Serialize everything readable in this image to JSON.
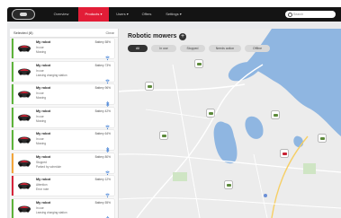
{
  "nav": {
    "items": [
      {
        "label": "Overview",
        "active": false
      },
      {
        "label": "Products ▾",
        "active": true
      },
      {
        "label": "Users ▾",
        "active": false
      },
      {
        "label": "Offers",
        "active": false
      },
      {
        "label": "Settings ▾",
        "active": false
      }
    ],
    "search_placeholder": "Search"
  },
  "sidebar": {
    "header": "Selected (8)",
    "clear": "Clear",
    "cards": [
      {
        "name": "My robot",
        "line1": "In use",
        "line2": "Mowing",
        "battery": "Battery 58%",
        "stripe": "#5db33a",
        "icon": "wifi"
      },
      {
        "name": "My robot",
        "line1": "In use",
        "line2": "Leaving charging station",
        "battery": "Battery 73%",
        "stripe": "#5db33a",
        "icon": "wifi"
      },
      {
        "name": "My robot",
        "line1": "In use",
        "line2": "Mowing",
        "battery": "Battery 96%",
        "stripe": "#5db33a",
        "icon": "bluetooth"
      },
      {
        "name": "My robot",
        "line1": "In use",
        "line2": "Mowing",
        "battery": "Battery 42%",
        "stripe": "#5db33a",
        "icon": "wifi"
      },
      {
        "name": "My robot",
        "line1": "In use",
        "line2": "Mowing",
        "battery": "Battery 64%",
        "stripe": "#5db33a",
        "icon": "bluetooth"
      },
      {
        "name": "My robot",
        "line1": "Stopped",
        "line2": "Parked by schedule",
        "battery": "Battery 80%",
        "stripe": "#f2a53a",
        "icon": "wifi"
      },
      {
        "name": "My robot",
        "line1": "Attention",
        "line2": "Error note",
        "battery": "Battery 12%",
        "stripe": "#d6243a",
        "icon": "wifi"
      },
      {
        "name": "My robot",
        "line1": "In use",
        "line2": "Leaving charging station",
        "battery": "Battery 55%",
        "stripe": "#5db33a",
        "icon": "bluetooth"
      }
    ]
  },
  "main": {
    "title": "Robotic mowers",
    "add": "+",
    "filters": [
      {
        "label": "All",
        "active": true
      },
      {
        "label": "In use",
        "active": false
      },
      {
        "label": "Stopped",
        "active": false
      },
      {
        "label": "Needs action",
        "active": false
      },
      {
        "label": "Offline",
        "active": false
      }
    ]
  },
  "map": {
    "pins": [
      {
        "status": "ok"
      },
      {
        "status": "ok"
      },
      {
        "status": "ok"
      },
      {
        "status": "ok"
      },
      {
        "status": "ok"
      },
      {
        "status": "ok"
      },
      {
        "status": "alert"
      },
      {
        "status": "ok"
      }
    ]
  },
  "colors": {
    "accent": "#e21d37",
    "topbar": "#141414",
    "ok": "#5db33a",
    "warn": "#f2a53a",
    "error": "#d6243a",
    "water": "#8fb6e1"
  }
}
